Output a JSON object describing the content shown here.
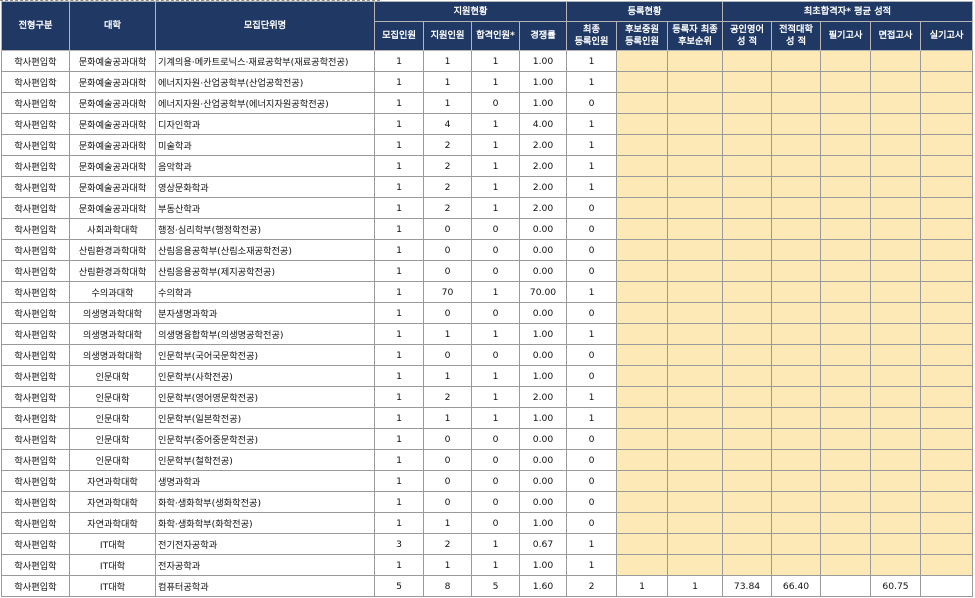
{
  "header": {
    "jeonhyeong": "전형구분",
    "daehak": "대학",
    "mojip_danwi": "모집단위명",
    "jiwon_group": "지원현황",
    "deungrok_group": "등록현황",
    "score_group": "최초합격자* 평균 성적",
    "cols": {
      "mojip": "모집인원",
      "jiwon": "지원인원",
      "hapgyeok": "합격인원*",
      "rate": "경쟁률",
      "final_reg_1": "최종",
      "final_reg_2": "등록인원",
      "hubo_reg_1": "후보중원",
      "hubo_reg_2": "등록인원",
      "hubo_rank_1": "등록자 최종",
      "hubo_rank_2": "후보순위",
      "english_1": "공인영어",
      "english_2": "성    적",
      "prev_univ_1": "전적대학",
      "prev_univ_2": "성    적",
      "written": "필기고사",
      "interview": "면접고사",
      "practical": "실기고사"
    }
  },
  "rows": [
    {
      "type": "학사편입학",
      "college": "문화예술공과대학",
      "unit": "기계의용·메카트로닉스·재료공학부(재료공학전공)",
      "mojip": "1",
      "jiwon": "1",
      "hap": "1",
      "rate": "1.00",
      "final": "1",
      "hubo_reg": "",
      "hubo_rank": "",
      "eng": "",
      "prev": "",
      "written": "",
      "interview": "",
      "practical": ""
    },
    {
      "type": "학사편입학",
      "college": "문화예술공과대학",
      "unit": "에너지자원·산업공학부(산업공학전공)",
      "mojip": "1",
      "jiwon": "1",
      "hap": "1",
      "rate": "1.00",
      "final": "1",
      "hubo_reg": "",
      "hubo_rank": "",
      "eng": "",
      "prev": "",
      "written": "",
      "interview": "",
      "practical": ""
    },
    {
      "type": "학사편입학",
      "college": "문화예술공과대학",
      "unit": "에너지자원·산업공학부(에너지자원공학전공)",
      "mojip": "1",
      "jiwon": "1",
      "hap": "0",
      "rate": "1.00",
      "final": "0",
      "hubo_reg": "",
      "hubo_rank": "",
      "eng": "",
      "prev": "",
      "written": "",
      "interview": "",
      "practical": ""
    },
    {
      "type": "학사편입학",
      "college": "문화예술공과대학",
      "unit": "디자인학과",
      "mojip": "1",
      "jiwon": "4",
      "hap": "1",
      "rate": "4.00",
      "final": "1",
      "hubo_reg": "",
      "hubo_rank": "",
      "eng": "",
      "prev": "",
      "written": "",
      "interview": "",
      "practical": ""
    },
    {
      "type": "학사편입학",
      "college": "문화예술공과대학",
      "unit": "미술학과",
      "mojip": "1",
      "jiwon": "2",
      "hap": "1",
      "rate": "2.00",
      "final": "1",
      "hubo_reg": "",
      "hubo_rank": "",
      "eng": "",
      "prev": "",
      "written": "",
      "interview": "",
      "practical": ""
    },
    {
      "type": "학사편입학",
      "college": "문화예술공과대학",
      "unit": "음악학과",
      "mojip": "1",
      "jiwon": "2",
      "hap": "1",
      "rate": "2.00",
      "final": "1",
      "hubo_reg": "",
      "hubo_rank": "",
      "eng": "",
      "prev": "",
      "written": "",
      "interview": "",
      "practical": ""
    },
    {
      "type": "학사편입학",
      "college": "문화예술공과대학",
      "unit": "영상문화학과",
      "mojip": "1",
      "jiwon": "2",
      "hap": "1",
      "rate": "2.00",
      "final": "1",
      "hubo_reg": "",
      "hubo_rank": "",
      "eng": "",
      "prev": "",
      "written": "",
      "interview": "",
      "practical": ""
    },
    {
      "type": "학사편입학",
      "college": "문화예술공과대학",
      "unit": "부동산학과",
      "mojip": "1",
      "jiwon": "2",
      "hap": "1",
      "rate": "2.00",
      "final": "0",
      "hubo_reg": "",
      "hubo_rank": "",
      "eng": "",
      "prev": "",
      "written": "",
      "interview": "",
      "practical": ""
    },
    {
      "type": "학사편입학",
      "college": "사회과학대학",
      "unit": "행정·심리학부(행정학전공)",
      "mojip": "1",
      "jiwon": "0",
      "hap": "0",
      "rate": "0.00",
      "final": "0",
      "hubo_reg": "",
      "hubo_rank": "",
      "eng": "",
      "prev": "",
      "written": "",
      "interview": "",
      "practical": ""
    },
    {
      "type": "학사편입학",
      "college": "산림환경과학대학",
      "unit": "산림응용공학부(산림소재공학전공)",
      "mojip": "1",
      "jiwon": "0",
      "hap": "0",
      "rate": "0.00",
      "final": "0",
      "hubo_reg": "",
      "hubo_rank": "",
      "eng": "",
      "prev": "",
      "written": "",
      "interview": "",
      "practical": ""
    },
    {
      "type": "학사편입학",
      "college": "산림환경과학대학",
      "unit": "산림응용공학부(제지공학전공)",
      "mojip": "1",
      "jiwon": "0",
      "hap": "0",
      "rate": "0.00",
      "final": "0",
      "hubo_reg": "",
      "hubo_rank": "",
      "eng": "",
      "prev": "",
      "written": "",
      "interview": "",
      "practical": ""
    },
    {
      "type": "학사편입학",
      "college": "수의과대학",
      "unit": "수의학과",
      "mojip": "1",
      "jiwon": "70",
      "hap": "1",
      "rate": "70.00",
      "final": "1",
      "hubo_reg": "",
      "hubo_rank": "",
      "eng": "",
      "prev": "",
      "written": "",
      "interview": "",
      "practical": ""
    },
    {
      "type": "학사편입학",
      "college": "의생명과학대학",
      "unit": "분자생명과학과",
      "mojip": "1",
      "jiwon": "0",
      "hap": "0",
      "rate": "0.00",
      "final": "0",
      "hubo_reg": "",
      "hubo_rank": "",
      "eng": "",
      "prev": "",
      "written": "",
      "interview": "",
      "practical": ""
    },
    {
      "type": "학사편입학",
      "college": "의생명과학대학",
      "unit": "의생명융합학부(의생명공학전공)",
      "mojip": "1",
      "jiwon": "1",
      "hap": "1",
      "rate": "1.00",
      "final": "1",
      "hubo_reg": "",
      "hubo_rank": "",
      "eng": "",
      "prev": "",
      "written": "",
      "interview": "",
      "practical": ""
    },
    {
      "type": "학사편입학",
      "college": "의생명과학대학",
      "unit": "인문학부(국어국문학전공)",
      "mojip": "1",
      "jiwon": "0",
      "hap": "0",
      "rate": "0.00",
      "final": "0",
      "hubo_reg": "",
      "hubo_rank": "",
      "eng": "",
      "prev": "",
      "written": "",
      "interview": "",
      "practical": ""
    },
    {
      "type": "학사편입학",
      "college": "인문대학",
      "unit": "인문학부(사학전공)",
      "mojip": "1",
      "jiwon": "1",
      "hap": "1",
      "rate": "1.00",
      "final": "0",
      "hubo_reg": "",
      "hubo_rank": "",
      "eng": "",
      "prev": "",
      "written": "",
      "interview": "",
      "practical": ""
    },
    {
      "type": "학사편입학",
      "college": "인문대학",
      "unit": "인문학부(영어영문학전공)",
      "mojip": "1",
      "jiwon": "2",
      "hap": "1",
      "rate": "2.00",
      "final": "1",
      "hubo_reg": "",
      "hubo_rank": "",
      "eng": "",
      "prev": "",
      "written": "",
      "interview": "",
      "practical": ""
    },
    {
      "type": "학사편입학",
      "college": "인문대학",
      "unit": "인문학부(일본학전공)",
      "mojip": "1",
      "jiwon": "1",
      "hap": "1",
      "rate": "1.00",
      "final": "1",
      "hubo_reg": "",
      "hubo_rank": "",
      "eng": "",
      "prev": "",
      "written": "",
      "interview": "",
      "practical": ""
    },
    {
      "type": "학사편입학",
      "college": "인문대학",
      "unit": "인문학부(중어중문학전공)",
      "mojip": "1",
      "jiwon": "0",
      "hap": "0",
      "rate": "0.00",
      "final": "0",
      "hubo_reg": "",
      "hubo_rank": "",
      "eng": "",
      "prev": "",
      "written": "",
      "interview": "",
      "practical": ""
    },
    {
      "type": "학사편입학",
      "college": "인문대학",
      "unit": "인문학부(철학전공)",
      "mojip": "1",
      "jiwon": "0",
      "hap": "0",
      "rate": "0.00",
      "final": "0",
      "hubo_reg": "",
      "hubo_rank": "",
      "eng": "",
      "prev": "",
      "written": "",
      "interview": "",
      "practical": ""
    },
    {
      "type": "학사편입학",
      "college": "자연과학대학",
      "unit": "생명과학과",
      "mojip": "1",
      "jiwon": "0",
      "hap": "0",
      "rate": "0.00",
      "final": "0",
      "hubo_reg": "",
      "hubo_rank": "",
      "eng": "",
      "prev": "",
      "written": "",
      "interview": "",
      "practical": ""
    },
    {
      "type": "학사편입학",
      "college": "자연과학대학",
      "unit": "화학·생화학부(생화학전공)",
      "mojip": "1",
      "jiwon": "0",
      "hap": "0",
      "rate": "0.00",
      "final": "0",
      "hubo_reg": "",
      "hubo_rank": "",
      "eng": "",
      "prev": "",
      "written": "",
      "interview": "",
      "practical": ""
    },
    {
      "type": "학사편입학",
      "college": "자연과학대학",
      "unit": "화학·생화학부(화학전공)",
      "mojip": "1",
      "jiwon": "1",
      "hap": "0",
      "rate": "1.00",
      "final": "0",
      "hubo_reg": "",
      "hubo_rank": "",
      "eng": "",
      "prev": "",
      "written": "",
      "interview": "",
      "practical": ""
    },
    {
      "type": "학사편입학",
      "college": "IT대학",
      "unit": "전기전자공학과",
      "mojip": "3",
      "jiwon": "2",
      "hap": "1",
      "rate": "0.67",
      "final": "1",
      "hubo_reg": "",
      "hubo_rank": "",
      "eng": "",
      "prev": "",
      "written": "",
      "interview": "",
      "practical": ""
    },
    {
      "type": "학사편입학",
      "college": "IT대학",
      "unit": "전자공학과",
      "mojip": "1",
      "jiwon": "1",
      "hap": "1",
      "rate": "1.00",
      "final": "1",
      "hubo_reg": "",
      "hubo_rank": "",
      "eng": "",
      "prev": "",
      "written": "",
      "interview": "",
      "practical": ""
    },
    {
      "type": "학사편입학",
      "college": "IT대학",
      "unit": "컴퓨터공학과",
      "mojip": "5",
      "jiwon": "8",
      "hap": "5",
      "rate": "1.60",
      "final": "2",
      "hubo_reg": "1",
      "hubo_rank": "1",
      "eng": "73.84",
      "prev": "66.40",
      "written": "",
      "interview": "60.75",
      "practical": ""
    }
  ]
}
